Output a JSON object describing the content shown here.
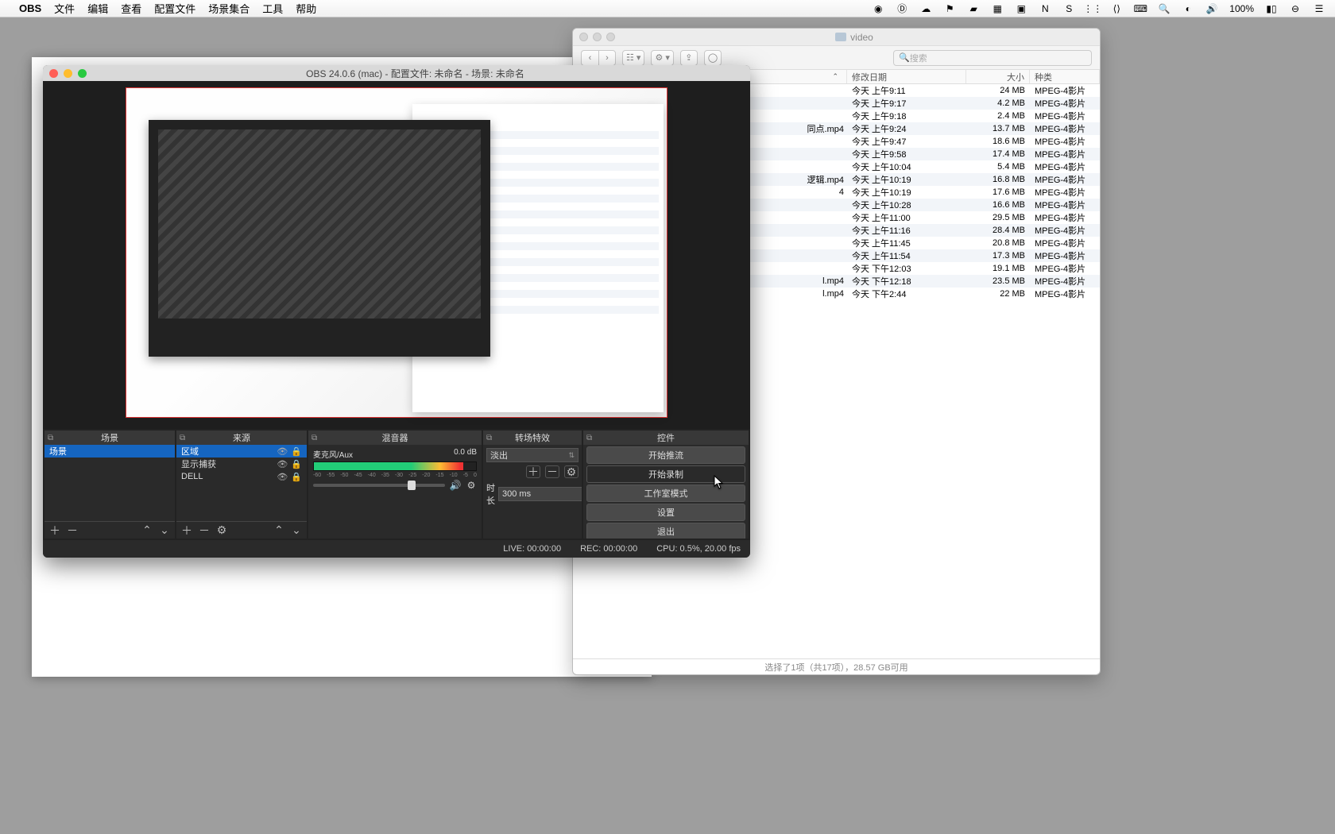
{
  "menubar": {
    "app": "OBS",
    "items": [
      "文件",
      "编辑",
      "查看",
      "配置文件",
      "场景集合",
      "工具",
      "帮助"
    ],
    "battery": "100%",
    "right_icons": [
      "obs-icon",
      "dropbox-icon",
      "creative-cloud-icon",
      "adobe-icon",
      "todo-icon",
      "grid-icon",
      "screen-icon",
      "n-icon",
      "s-icon",
      "bt-icon",
      "code-icon",
      "keyboard-icon",
      "search-icon",
      "siri-icon",
      "volume-icon",
      "battery-icon",
      "toggle-icon",
      "menu-icon"
    ]
  },
  "finder": {
    "title": "video",
    "search_placeholder": "搜索",
    "headers": {
      "name": "",
      "date": "修改日期",
      "size": "大小",
      "kind": "种类"
    },
    "rows": [
      {
        "name": "",
        "date": "今天 上午9:11",
        "size": "24 MB",
        "kind": "MPEG-4影片"
      },
      {
        "name": "",
        "date": "今天 上午9:17",
        "size": "4.2 MB",
        "kind": "MPEG-4影片"
      },
      {
        "name": "",
        "date": "今天 上午9:18",
        "size": "2.4 MB",
        "kind": "MPEG-4影片"
      },
      {
        "name": "同点.mp4",
        "date": "今天 上午9:24",
        "size": "13.7 MB",
        "kind": "MPEG-4影片"
      },
      {
        "name": "",
        "date": "今天 上午9:47",
        "size": "18.6 MB",
        "kind": "MPEG-4影片"
      },
      {
        "name": "",
        "date": "今天 上午9:58",
        "size": "17.4 MB",
        "kind": "MPEG-4影片"
      },
      {
        "name": "",
        "date": "今天 上午10:04",
        "size": "5.4 MB",
        "kind": "MPEG-4影片"
      },
      {
        "name": "逻辑.mp4",
        "date": "今天 上午10:19",
        "size": "16.8 MB",
        "kind": "MPEG-4影片"
      },
      {
        "name": "4",
        "date": "今天 上午10:19",
        "size": "17.6 MB",
        "kind": "MPEG-4影片"
      },
      {
        "name": "",
        "date": "今天 上午10:28",
        "size": "16.6 MB",
        "kind": "MPEG-4影片"
      },
      {
        "name": "",
        "date": "今天 上午11:00",
        "size": "29.5 MB",
        "kind": "MPEG-4影片"
      },
      {
        "name": "",
        "date": "今天 上午11:16",
        "size": "28.4 MB",
        "kind": "MPEG-4影片"
      },
      {
        "name": "",
        "date": "今天 上午11:45",
        "size": "20.8 MB",
        "kind": "MPEG-4影片"
      },
      {
        "name": "",
        "date": "今天 上午11:54",
        "size": "17.3 MB",
        "kind": "MPEG-4影片"
      },
      {
        "name": "",
        "date": "今天 下午12:03",
        "size": "19.1 MB",
        "kind": "MPEG-4影片"
      },
      {
        "name": "l.mp4",
        "date": "今天 下午12:18",
        "size": "23.5 MB",
        "kind": "MPEG-4影片"
      },
      {
        "name": "l.mp4",
        "date": "今天 下午2:44",
        "size": "22 MB",
        "kind": "MPEG-4影片"
      }
    ],
    "status": "选择了1项（共17项），28.57 GB可用"
  },
  "obs": {
    "title": "OBS 24.0.6 (mac) - 配置文件: 未命名 - 场景: 未命名",
    "panels": {
      "scenes": {
        "title": "场景",
        "items": [
          "场景"
        ]
      },
      "sources": {
        "title": "来源",
        "items": [
          "区域",
          "显示捕获",
          "DELL"
        ]
      },
      "mixer": {
        "title": "混音器",
        "channel": "麦克风/Aux",
        "level": "0.0 dB",
        "ticks": [
          "-60",
          "-55",
          "-50",
          "-45",
          "-40",
          "-35",
          "-30",
          "-25",
          "-20",
          "-15",
          "-10",
          "-5",
          "0"
        ]
      },
      "transitions": {
        "title": "转场特效",
        "selected": "淡出",
        "dur_label": "时长",
        "dur_value": "300 ms"
      },
      "controls": {
        "title": "控件",
        "buttons": [
          "开始推流",
          "开始录制",
          "工作室模式",
          "设置",
          "退出"
        ]
      }
    },
    "status": {
      "live": "LIVE: 00:00:00",
      "rec": "REC: 00:00:00",
      "cpu": "CPU: 0.5%, 20.00 fps"
    }
  }
}
